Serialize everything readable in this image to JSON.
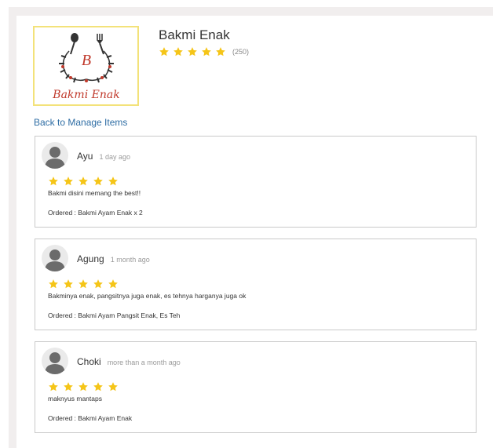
{
  "store": {
    "name": "Bakmi Enak",
    "logo_letter": "B",
    "logo_text": "Bakmi Enak",
    "rating_stars": 5,
    "rating_count": "(250)"
  },
  "back_link": "Back to Manage Items",
  "colors": {
    "star": "#f5c518",
    "link": "#2e6da4",
    "logo_border": "#f3e27a",
    "logo_text": "#c0392b"
  },
  "reviews": [
    {
      "name": "Ayu",
      "time": "1 day ago",
      "stars": 5,
      "comment": "Bakmi disini memang the best!!",
      "ordered": "Ordered : Bakmi Ayam Enak x 2"
    },
    {
      "name": "Agung",
      "time": "1 month ago",
      "stars": 5,
      "comment": "Bakminya enak, pangsitnya juga enak, es tehnya harganya juga ok",
      "ordered": "Ordered : Bakmi Ayam Pangsit Enak, Es Teh"
    },
    {
      "name": "Choki",
      "time": "more than a month ago",
      "stars": 5,
      "comment": "maknyus mantaps",
      "ordered": "Ordered : Bakmi Ayam Enak"
    }
  ]
}
